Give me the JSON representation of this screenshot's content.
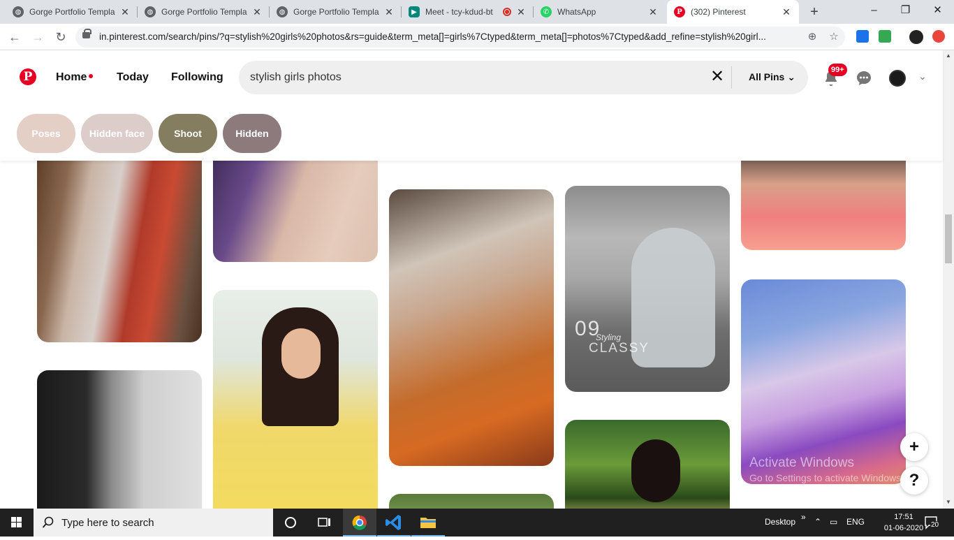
{
  "browser": {
    "tabs": [
      {
        "title": "Gorge Portfolio Templa",
        "favicon": "globe-icon"
      },
      {
        "title": "Gorge Portfolio Templa",
        "favicon": "globe-icon"
      },
      {
        "title": "Gorge Portfolio Templa",
        "favicon": "globe-icon"
      },
      {
        "title": "Meet - tcy-kdud-bt",
        "favicon": "meet-icon",
        "recording": true
      },
      {
        "title": "WhatsApp",
        "favicon": "whatsapp-icon"
      },
      {
        "title": "(302) Pinterest",
        "favicon": "pinterest-icon",
        "active": true
      }
    ],
    "new_tab": "+",
    "url": "in.pinterest.com/search/pins/?q=stylish%20girls%20photos&rs=guide&term_meta[]=girls%7Ctyped&term_meta[]=photos%7Ctyped&add_refine=stylish%20girl..."
  },
  "pinterest": {
    "logo": "P",
    "nav": {
      "home": "Home",
      "today": "Today",
      "following": "Following"
    },
    "search": {
      "value": "stylish girls photos",
      "clear": "✕",
      "filter": "All Pins"
    },
    "notifications_badge": "99+",
    "chips": [
      {
        "label": "Poses",
        "color": "#e3cfc5"
      },
      {
        "label": "Hidden face",
        "color": "#dccdca"
      },
      {
        "label": "Shoot",
        "color": "#857d5f"
      },
      {
        "label": "Hidden",
        "color": "#8c7a7d"
      }
    ],
    "pin_overlay_text": {
      "number": "09",
      "word": "CLASSY",
      "tag": "Styling"
    },
    "fab": {
      "add": "+",
      "help": "?"
    }
  },
  "watermark": {
    "line1": "Activate Windows",
    "line2": "Go to Settings to activate Windows."
  },
  "taskbar": {
    "search_placeholder": "Type here to search",
    "desktop_label": "Desktop",
    "language": "ENG",
    "time": "17:51",
    "date": "01-06-2020",
    "notifications": "20"
  },
  "colors": {
    "pinterest_red": "#e60023",
    "taskbar": "#202020"
  }
}
